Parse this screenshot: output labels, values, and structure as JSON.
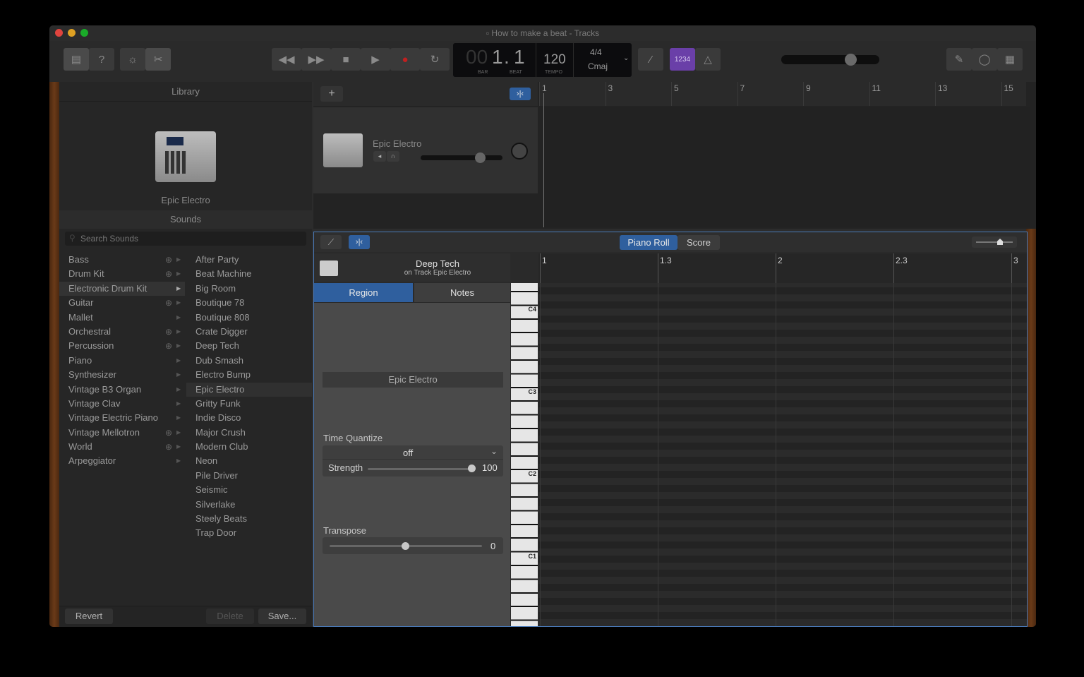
{
  "window": {
    "title": "How to make a beat - Tracks"
  },
  "lcd": {
    "bar": "1",
    "beat": "1",
    "bar_label": "BAR",
    "beat_label": "BEAT",
    "tempo": "120",
    "tempo_label": "TEMPO",
    "signature": "4/4",
    "key": "Cmaj"
  },
  "toolbar": {
    "count_in": "1234"
  },
  "library": {
    "header": "Library",
    "patch_name": "Epic Electro",
    "sounds_header": "Sounds",
    "search_placeholder": "Search Sounds",
    "categories": [
      "Bass",
      "Drum Kit",
      "Electronic Drum Kit",
      "Guitar",
      "Mallet",
      "Orchestral",
      "Percussion",
      "Piano",
      "Synthesizer",
      "Vintage B3 Organ",
      "Vintage Clav",
      "Vintage Electric Piano",
      "Vintage Mellotron",
      "World",
      "Arpeggiator"
    ],
    "sounds": [
      "After Party",
      "Beat Machine",
      "Big Room",
      "Boutique 78",
      "Boutique 808",
      "Crate Digger",
      "Deep Tech",
      "Dub Smash",
      "Electro Bump",
      "Epic Electro",
      "Gritty Funk",
      "Indie Disco",
      "Major Crush",
      "Modern Club",
      "Neon",
      "Pile Driver",
      "Seismic",
      "Silverlake",
      "Steely Beats",
      "Trap Door"
    ],
    "revert": "Revert",
    "delete": "Delete",
    "save": "Save..."
  },
  "tracks": {
    "ruler": [
      "1",
      "3",
      "5",
      "7",
      "9",
      "11",
      "13",
      "15"
    ],
    "track_name": "Epic Electro",
    "add_button": "+",
    "volume_fraction": 0.72
  },
  "editor": {
    "tab_piano": "Piano Roll",
    "tab_score": "Score",
    "region_name": "Deep Tech",
    "region_sub": "on Track Epic Electro",
    "tab_region": "Region",
    "tab_notes": "Notes",
    "region_field": "Epic Electro",
    "quantize_label": "Time Quantize",
    "quantize_value": "off",
    "strength_label": "Strength",
    "strength_value": "100",
    "transpose_label": "Transpose",
    "transpose_value": "0",
    "ruler": [
      "1",
      "1.3",
      "2",
      "2.3",
      "3"
    ],
    "octaves": [
      "C4",
      "C3",
      "C2",
      "C1"
    ]
  }
}
